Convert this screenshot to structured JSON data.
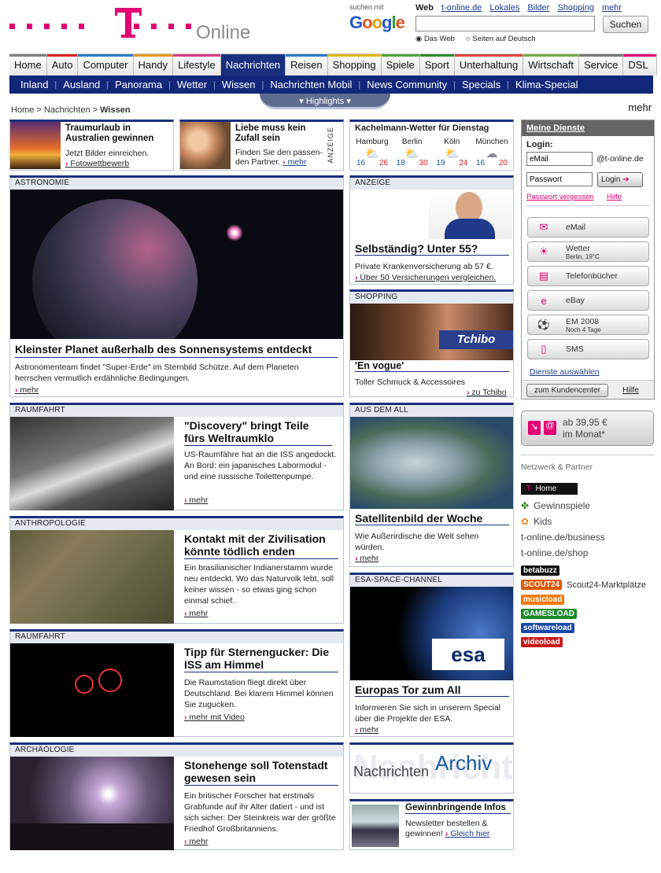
{
  "header": {
    "brand": "T",
    "online": "Online",
    "google_label": "suchen mit",
    "google_logo": "Google",
    "search_tabs": [
      "Web",
      "t-online.de",
      "Lokales",
      "Bilder",
      "Shopping",
      "mehr"
    ],
    "search_value": "",
    "search_button": "Suchen",
    "radio_web": "Das Web",
    "radio_de": "Seiten auf Deutsch"
  },
  "nav": [
    {
      "label": "Home",
      "c": "#7f7f7f"
    },
    {
      "label": "Auto",
      "c": "#d22"
    },
    {
      "label": "Computer",
      "c": "#2a7bc6"
    },
    {
      "label": "Handy",
      "c": "#e09a17"
    },
    {
      "label": "Lifestyle",
      "c": "#d43c88"
    },
    {
      "label": "Nachrichten",
      "c": "#1a2f7e"
    },
    {
      "label": "Reisen",
      "c": "#2a7bc6"
    },
    {
      "label": "Shopping",
      "c": "#e0b817"
    },
    {
      "label": "Spiele",
      "c": "#4aa83a"
    },
    {
      "label": "Sport",
      "c": "#2e8b2e"
    },
    {
      "label": "Unterhaltung",
      "c": "#d44"
    },
    {
      "label": "Wirtschaft",
      "c": "#7a4"
    },
    {
      "label": "Service",
      "c": "#777"
    },
    {
      "label": "DSL & mehr",
      "c": "#e20074"
    }
  ],
  "subnav": [
    "Inland",
    "Ausland",
    "Panorama",
    "Wetter",
    "Wissen",
    "Nachrichten Mobil",
    "News Community",
    "Specials",
    "Klima-Special"
  ],
  "highlights": "Highlights",
  "breadcrumb": {
    "a": "Home",
    "b": "Nachrichten",
    "cur": "Wissen"
  },
  "teaser1": {
    "title": "Traumurlaub in Australien gewinnen",
    "text": "Jetzt Bilder einreichen.",
    "link": "Fotowettbewerb"
  },
  "teaser2": {
    "title": "Liebe muss kein Zufall sein",
    "text": "Finden Sie den passen-den Partner.",
    "link": "mehr",
    "side": "ANZEIGE"
  },
  "weather": {
    "title": "Kachelmann-Wetter für Dienstag",
    "cities": [
      {
        "name": "Hamburg",
        "lo": "16",
        "hi": "26",
        "icon": "sun-cloud-icon"
      },
      {
        "name": "Berlin",
        "lo": "18",
        "hi": "30",
        "icon": "sun-cloud-icon"
      },
      {
        "name": "Köln",
        "lo": "19",
        "hi": "24",
        "icon": "sun-cloud-icon"
      },
      {
        "name": "München",
        "lo": "16",
        "hi": "20",
        "icon": "rain-cloud-icon"
      }
    ]
  },
  "astro": {
    "sect": "ASTRONOMIE",
    "title": "Kleinster Planet außerhalb des Sonnensystems entdeckt",
    "text": "Astronomenteam findet \"Super-Erde\" im Sternbild Schütze. Auf dem Planeten herrschen vermutlich erdähnliche Bedingungen.",
    "more": "mehr"
  },
  "ad": {
    "sect": "ANZEIGE",
    "title": "Selbständig? Unter 55?",
    "text": "Private Krankenversicherung ab 57 €.",
    "link": "Über 50 Versicherungen vergleichen."
  },
  "shopping": {
    "sect": "SHOPPING",
    "brand": "Tchibo",
    "title": "'En vogue'",
    "text": "Toller Schmuck & Accessoires",
    "link": "zu Tchibo"
  },
  "disc": {
    "sect": "RAUMFAHRT",
    "title": "\"Discovery\" bringt Teile fürs Weltraumklo",
    "text": "US-Raumfähre hat an die ISS angedockt. An Bord: ein japanisches Labormodul - und eine russische Toilettenpumpe.",
    "more": "mehr"
  },
  "sat": {
    "sect": "AUS DEM ALL",
    "title": "Satellitenbild der Woche",
    "text": "Wie Außerirdische die Welt sehen würden.",
    "more": "mehr"
  },
  "anthro": {
    "sect": "ANTHROPOLOGIE",
    "title": "Kontakt mit der Zivilisation könnte tödlich enden",
    "text": "Ein brasilianischer Indianerstamm wurde neu entdeckt. Wo das Naturvolk lebt, soll keiner wissen - so etwas ging schon einmal schief.",
    "more": "mehr"
  },
  "esa": {
    "sect": "ESA-SPACE-CHANNEL",
    "logo": "esa",
    "title": "Europas Tor zum All",
    "text": "Informieren Sie sich in unserem Special über die Projekte der ESA.",
    "more": "mehr"
  },
  "iss": {
    "sect": "RAUMFAHRT",
    "title": "Tipp für Sternengucker: Die ISS am Himmel",
    "text": "Die Raumstation fliegt direkt über Deutschland. Bei klarem Himmel können Sie zugucken.",
    "more": "mehr mit Video"
  },
  "stone": {
    "sect": "ARCHÄOLOGIE",
    "title": "Stonehenge soll Totenstadt gewesen sein",
    "text": "Ein britischer Forscher hat erstmals Grabfunde auf ihr Alter datiert - und ist sich sicher: Der Steinkreis war der größte Friedhof Großbritanniens.",
    "more": "mehr"
  },
  "archiv": {
    "a": "Nachrichten",
    "b": "Archiv",
    "bg": "Nachrichten"
  },
  "newsletter": {
    "title": "Gewinnbringende Infos",
    "text": "Newsletter bestellen & gewinnen!",
    "link": "Gleich hier"
  },
  "dienste": {
    "title": "Meine Dienste",
    "login": "Login:",
    "email": "eMail",
    "domain": "@t-online.de",
    "pw": "Passwort",
    "btn": "Login",
    "forgot": "Passwort vergessen",
    "help": "Hilfe",
    "services": [
      {
        "label": "eMail",
        "sub": "",
        "icon": "mail-icon"
      },
      {
        "label": "Wetter",
        "sub": "Berlin, 19°C",
        "icon": "weather-icon"
      },
      {
        "label": "Telefonbücher",
        "sub": "",
        "icon": "phonebook-icon"
      },
      {
        "label": "eBay",
        "sub": "",
        "icon": "ebay-icon"
      },
      {
        "label": "EM 2008",
        "sub": "Noch 4 Tage",
        "icon": "football-icon"
      },
      {
        "label": "SMS",
        "sub": "",
        "icon": "sms-icon"
      }
    ],
    "choose": "Dienste auswählen",
    "center": "zum Kundencenter",
    "help2": "Hilfe"
  },
  "promo": {
    "a": "ab 39,95 €",
    "b": "im Monat*"
  },
  "partner": {
    "title": "Netzwerk & Partner",
    "home": "Home",
    "items": [
      "Gewinnspiele",
      "Kids",
      "t-online.de/business",
      "t-online.de/shop"
    ],
    "brands": [
      "betabuzz",
      "SCOUT24",
      "Scout24-Marktplätze",
      "musicload",
      "GAMESLOAD",
      "softwareload",
      "videoload"
    ]
  }
}
